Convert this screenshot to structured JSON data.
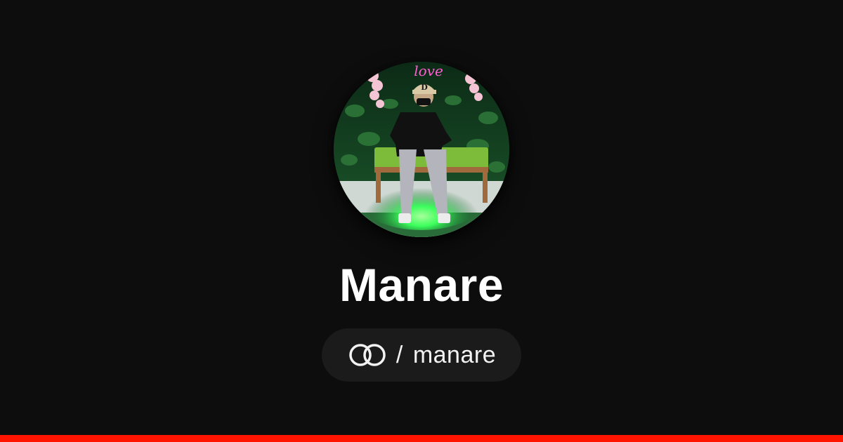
{
  "profile": {
    "display_name": "Manare",
    "handle_separator": "/",
    "handle": "manare",
    "neon_sign_text": "love",
    "cap_logo_text": "D"
  },
  "icons": {
    "platform_logo": "interlocked-rings-logo-icon"
  },
  "colors": {
    "background": "#0d0d0d",
    "pill_background": "#1b1b1b",
    "text": "#ffffff",
    "accent_bar": "#ff1400",
    "neon": "#ff5fd2"
  }
}
